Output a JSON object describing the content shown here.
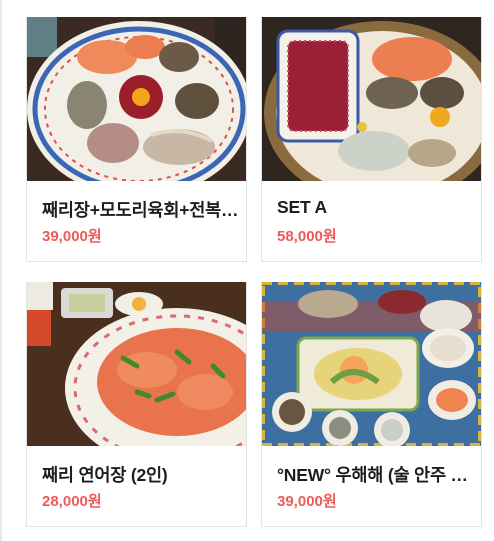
{
  "products": [
    {
      "name": "째리장+모도리육회+전복장 세트",
      "price": "39,000원"
    },
    {
      "name": "SET A",
      "price": "58,000원"
    },
    {
      "name": "째리 연어장 (2인)",
      "price": "28,000원"
    },
    {
      "name": "°NEW° 우해해 (술 안주 세트)",
      "price": "39,000원"
    }
  ]
}
